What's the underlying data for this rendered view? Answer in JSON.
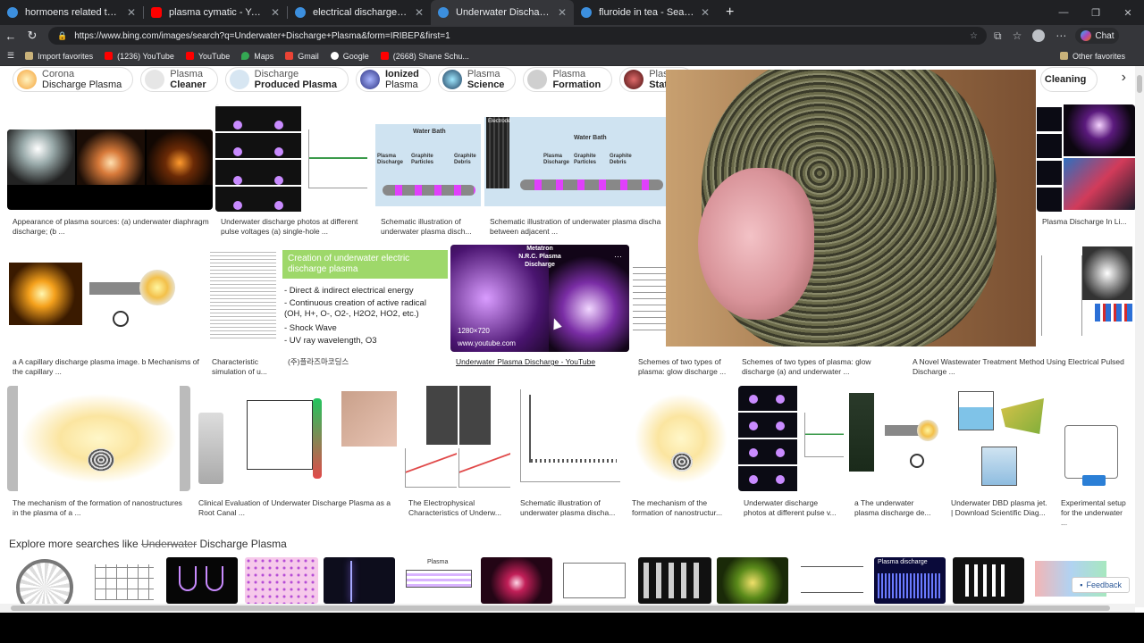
{
  "browser": {
    "tabs": [
      {
        "title": "hormoens related to pair bonding",
        "favicon": "bing-icon",
        "active": false
      },
      {
        "title": "plasma cymatic - YouTube",
        "favicon": "youtube-icon",
        "active": false
      },
      {
        "title": "electrical discharge of plasma - Se",
        "favicon": "bing-icon",
        "active": false
      },
      {
        "title": "Underwater Discharge Plasma - Se",
        "favicon": "bing-icon",
        "active": true
      },
      {
        "title": "fluroide in tea - Search",
        "favicon": "bing-icon",
        "active": false
      }
    ],
    "new_tab": "+",
    "url": "https://www.bing.com/images/search?q=Underwater+Discharge+Plasma&form=IRIBEP&first=1",
    "chat_label": "Chat",
    "bookmarks": [
      {
        "label": "Import favorites",
        "icon": "import-icon"
      },
      {
        "label": "(1236) YouTube",
        "icon": "youtube-icon"
      },
      {
        "label": "YouTube",
        "icon": "youtube-icon"
      },
      {
        "label": "Maps",
        "icon": "maps-icon"
      },
      {
        "label": "Gmail",
        "icon": "gmail-icon"
      },
      {
        "label": "Google",
        "icon": "google-icon"
      },
      {
        "label": "(2668) Shane Schu...",
        "icon": "youtube-icon"
      }
    ],
    "other_favorites": "Other favorites"
  },
  "chips": [
    {
      "l1": "Corona",
      "l2": "Discharge Plasma",
      "color": "#f4b24a"
    },
    {
      "l1": "Plasma",
      "l2": "Cleaner",
      "color": "#e6e6e6"
    },
    {
      "l1": "Discharge",
      "l2": "Produced Plasma",
      "color": "#d7e6f2"
    },
    {
      "l1": "Ionized",
      "l2": "Plasma",
      "color": "#3a3f8f"
    },
    {
      "l1": "Plasma",
      "l2": "Science",
      "color": "#1c3a5a"
    },
    {
      "l1": "Plasma",
      "l2": "Formation",
      "color": "#cfcfcf"
    },
    {
      "l1": "Plasma",
      "l2": "State",
      "color": "#5a1a1a"
    },
    {
      "l1": "",
      "l2": "Cleaning",
      "color": "#dddddd"
    }
  ],
  "row1": [
    {
      "caption": "Appearance of plasma sources: (a) underwater diaphragm discharge; (b ..."
    },
    {
      "caption": "Underwater discharge photos at different pulse voltages (a) single-hole ..."
    },
    {
      "caption": "Schematic illustration of underwater plasma disch..."
    },
    {
      "caption": "Schematic illustration of underwater plasma discha between adjacent ..."
    },
    {
      "caption": "Plasma Discharge In Li..."
    }
  ],
  "row2": [
    {
      "caption": "a A capillary discharge plasma image. b Mechanisms of the capillary ..."
    },
    {
      "caption": "Characteristic simulation of u..."
    },
    {
      "caption": "(주)플라즈마코딩스"
    },
    {
      "caption": "Underwater Plasma Discharge - YouTube"
    },
    {
      "caption": "Schemes of two types of plasma: glow discharge ..."
    },
    {
      "caption": "Schemes of two types of plasma: glow discharge (a) and underwater ..."
    },
    {
      "caption": "A Novel Wastewater Treatment Method Using Electrical Pulsed Discharge ..."
    }
  ],
  "row2_slide": {
    "title": "Creation of underwater electric discharge plasma",
    "bullets": [
      "- Direct & indirect electrical energy",
      "- Continuous creation of active radical (OH, H+, O-, O2-, H2O2, HO2, etc.)",
      "- Shock Wave",
      "- UV ray wavelength, O3"
    ]
  },
  "video": {
    "title": "Metatron N.R.C. Plasma Discharge",
    "resolution": "1280×720",
    "source": "www.youtube.com"
  },
  "row1_labels": {
    "water_bath": "Water Bath",
    "plasma_discharge": "Plasma Discharge",
    "graphite_particles": "Graphite Particles",
    "graphite_debris": "Graphite Debris",
    "electrode": "Electrode"
  },
  "row3": [
    {
      "caption": "The mechanism of the formation of nanostructures in the plasma of a ..."
    },
    {
      "caption": "Clinical Evaluation of Underwater Discharge Plasma as a Root Canal ..."
    },
    {
      "caption": "The Electrophysical Characteristics of Underw..."
    },
    {
      "caption": "Schematic illustration of underwater plasma discha..."
    },
    {
      "caption": "The mechanism of the formation of nanostructur..."
    },
    {
      "caption": "Underwater discharge photos at different pulse v..."
    },
    {
      "caption": "a The underwater plasma discharge de..."
    },
    {
      "caption": "Underwater DBD plasma jet. | Download Scientific Diag..."
    },
    {
      "caption": "Experimental setup for the underwater ..."
    }
  ],
  "explore": {
    "prefix": "Explore more searches like",
    "struck": "Underwater",
    "suffix": "Discharge Plasma"
  },
  "strip_labels": {
    "plasma": "Plasma",
    "plasma_discharge": "Plasma discharge"
  },
  "feedback": "Feedback"
}
